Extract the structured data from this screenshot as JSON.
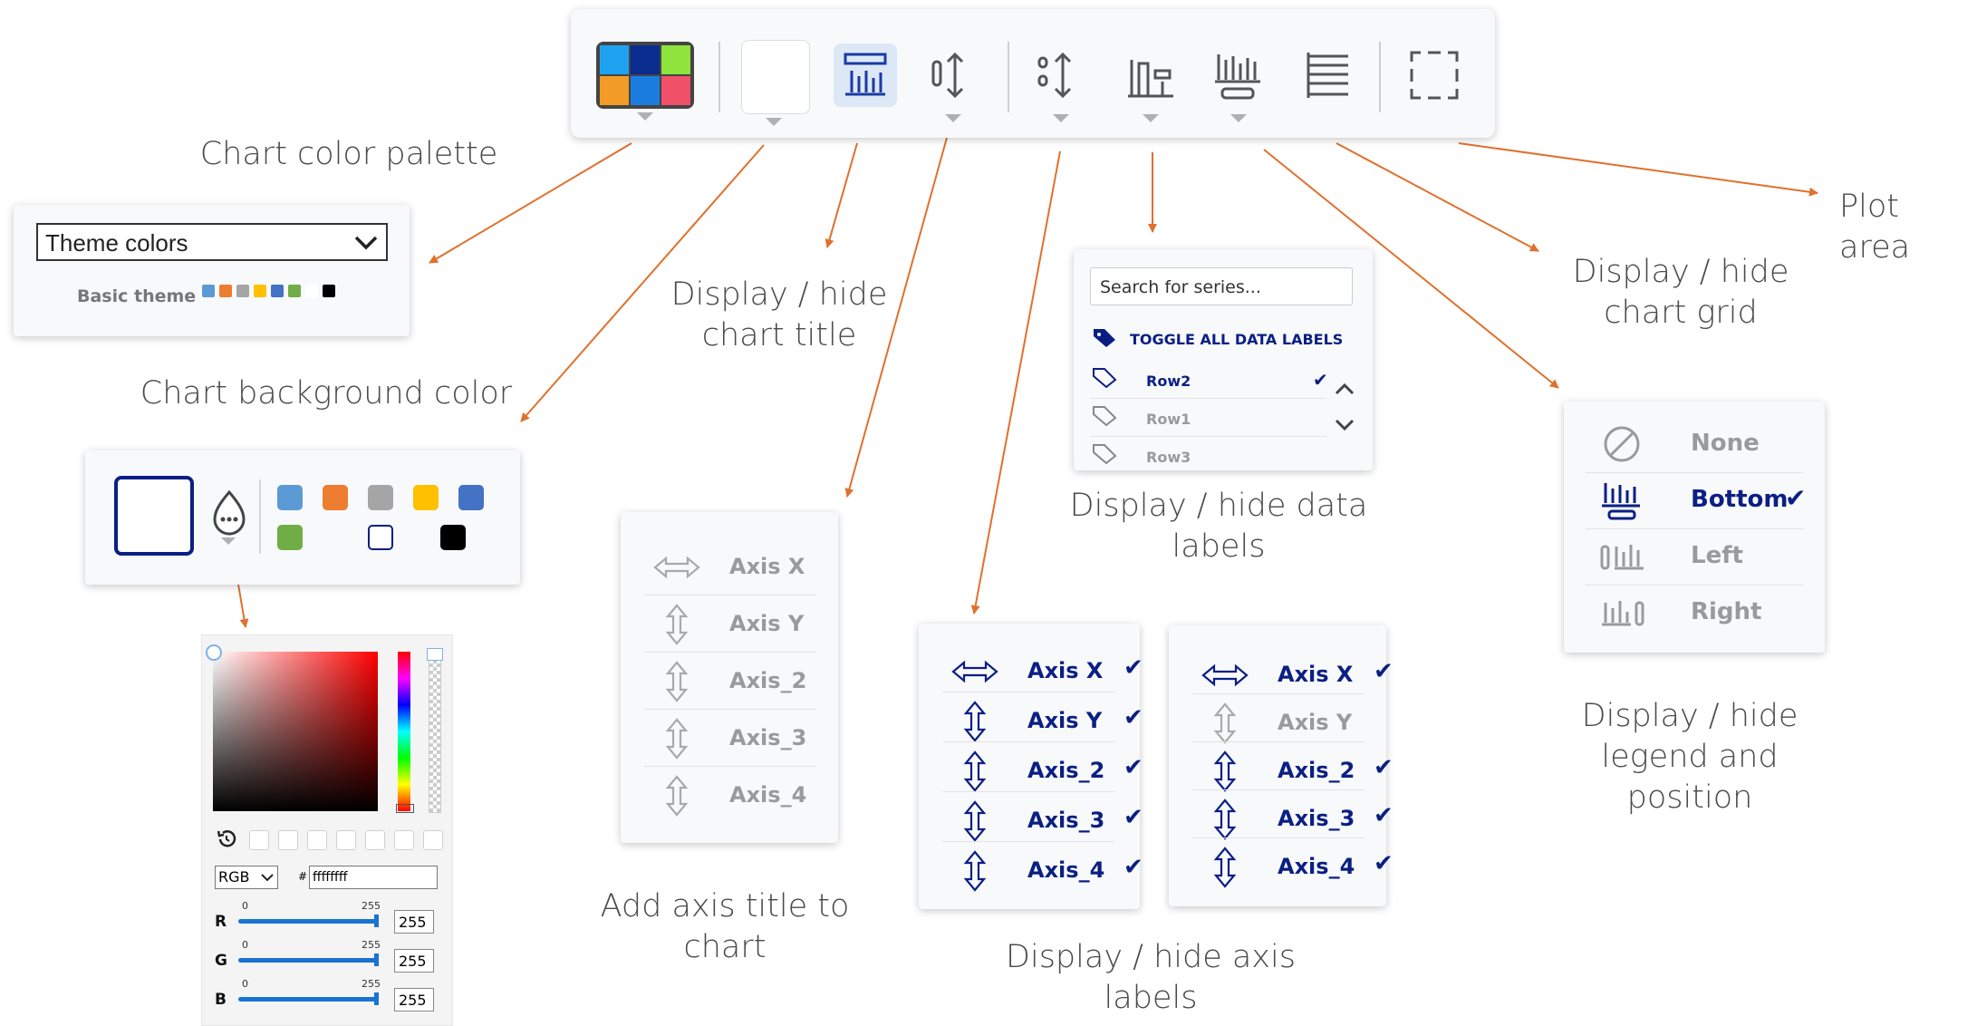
{
  "captions": {
    "palette": "Chart color palette",
    "bg_color": "Chart background color",
    "title": "Display / hide\nchart title",
    "axis_title": "Add axis title to\nchart",
    "axis_labels": "Display / hide axis\nlabels",
    "data_labels": "Display / hide data\nlabels",
    "grid": "Display / hide\nchart grid",
    "legend": "Display / hide\nlegend and\nposition",
    "plot_area": "Plot area"
  },
  "palette_panel": {
    "select_value": "Theme colors",
    "theme_label": "Basic theme",
    "swatches": [
      "#5b9bd5",
      "#ed7d31",
      "#a5a5a5",
      "#ffc000",
      "#4472c4",
      "#70ad47",
      "#ffffff",
      "#000000"
    ]
  },
  "bg_panel": {
    "selected_color": "#ffffff",
    "swatches": [
      "#5b9bd5",
      "#ed7d31",
      "#a5a5a5",
      "#ffc000",
      "#4472c4",
      "#70ad47",
      "#ffffff",
      "#000000"
    ]
  },
  "color_picker": {
    "mode": "RGB",
    "hex_prefix": "#",
    "hex": "ffffffff",
    "r_label": "R",
    "g_label": "G",
    "b_label": "B",
    "min": "0",
    "max": "255",
    "r": "255",
    "g": "255",
    "b": "255"
  },
  "axis_title_menu": [
    {
      "label": "Axis X",
      "active": false
    },
    {
      "label": "Axis Y",
      "active": false
    },
    {
      "label": "Axis_2",
      "active": false
    },
    {
      "label": "Axis_3",
      "active": false
    },
    {
      "label": "Axis_4",
      "active": false
    }
  ],
  "axis_labels_menu_a": [
    {
      "label": "Axis X",
      "active": true
    },
    {
      "label": "Axis Y",
      "active": true
    },
    {
      "label": "Axis_2",
      "active": true
    },
    {
      "label": "Axis_3",
      "active": true
    },
    {
      "label": "Axis_4",
      "active": true
    }
  ],
  "axis_labels_menu_b": [
    {
      "label": "Axis X",
      "active": true
    },
    {
      "label": "Axis Y",
      "active": false
    },
    {
      "label": "Axis_2",
      "active": true
    },
    {
      "label": "Axis_3",
      "active": true
    },
    {
      "label": "Axis_4",
      "active": true
    }
  ],
  "data_labels_panel": {
    "search_placeholder": "Search for series...",
    "toggle_all": "TOGGLE ALL DATA LABELS",
    "rows": [
      {
        "label": "Row2",
        "active": true
      },
      {
        "label": "Row1",
        "active": false
      },
      {
        "label": "Row3",
        "active": false
      }
    ]
  },
  "legend_menu": [
    {
      "label": "None",
      "active": false
    },
    {
      "label": "Bottom",
      "active": true
    },
    {
      "label": "Left",
      "active": false
    },
    {
      "label": "Right",
      "active": false
    }
  ],
  "colors": {
    "accent_blue": "#0b1f83",
    "arrow_orange": "#e0702d",
    "inactive_gray": "#a9a9a9"
  }
}
